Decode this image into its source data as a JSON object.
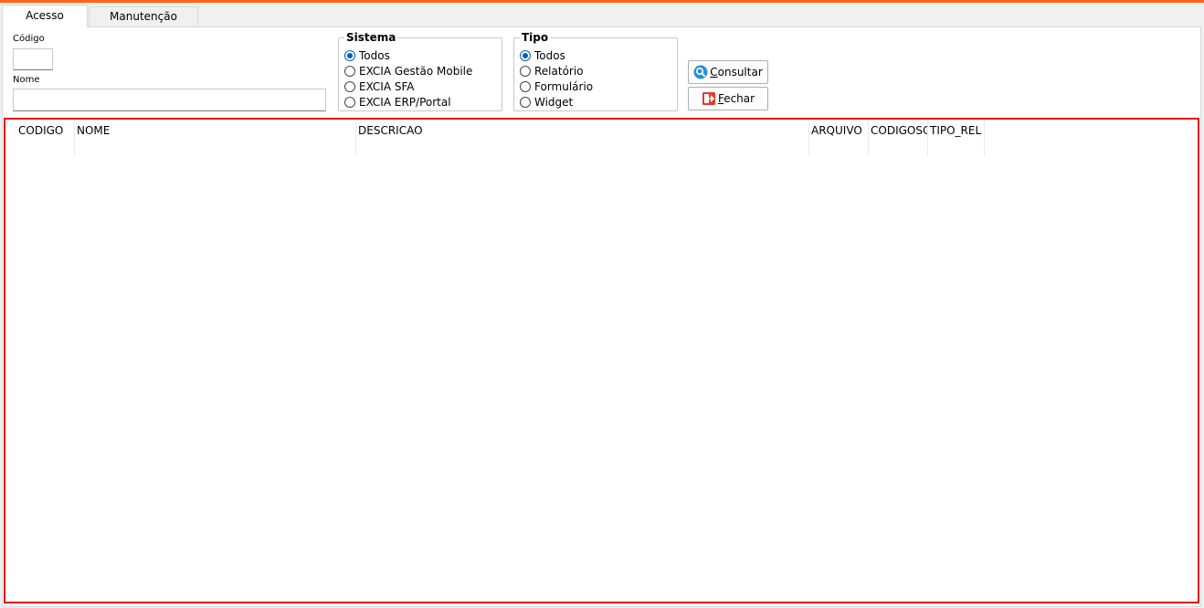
{
  "tabs": [
    {
      "label": "Acesso",
      "active": true
    },
    {
      "label": "Manutenção",
      "active": false
    }
  ],
  "filters": {
    "codigo_label": "Código",
    "codigo_value": "",
    "nome_label": "Nome",
    "nome_value": ""
  },
  "sistema": {
    "title": "Sistema",
    "options": [
      "Todos",
      "EXCIA Gestão Mobile",
      "EXCIA SFA",
      "EXCIA ERP/Portal"
    ],
    "selected": "Todos"
  },
  "tipo": {
    "title": "Tipo",
    "options": [
      "Todos",
      "Relatório",
      "Formulário",
      "Widget"
    ],
    "selected": "Todos"
  },
  "buttons": {
    "consultar": "Consultar",
    "fechar": "Fechar"
  },
  "grid": {
    "columns": [
      "CODIGO",
      "NOME",
      "DESCRICAO",
      "ARQUIVO",
      "CODIGOSC",
      "TIPO_REL"
    ],
    "rows": []
  },
  "colors": {
    "accent": "#ff6418",
    "highlight_border": "#e01010",
    "radio_selected": "#0060c0"
  }
}
